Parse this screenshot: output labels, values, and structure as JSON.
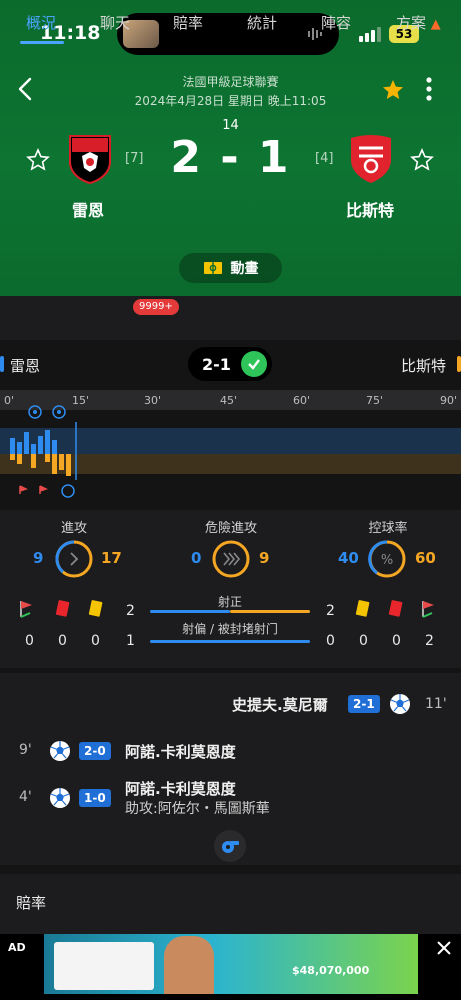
{
  "status_bar": {
    "time": "11:18",
    "battery": "53"
  },
  "match": {
    "league": "法國甲級足球聯賽",
    "datetime": "2024年4月28日 星期日 晚上11:05",
    "minute": "14",
    "score": "2 - 1",
    "home": {
      "name": "雷恩",
      "rank": "[7]"
    },
    "away": {
      "name": "比斯特",
      "rank": "[4]"
    },
    "animation_label": "動畫"
  },
  "tabs": [
    {
      "label": "概況",
      "active": true
    },
    {
      "label": "聊天"
    },
    {
      "label": "賠率"
    },
    {
      "label": "統計"
    },
    {
      "label": "陣容"
    },
    {
      "label": "方案"
    }
  ],
  "chat_badge": "9999+",
  "summary": {
    "home_name": "雷恩",
    "away_name": "比斯特",
    "score": "2-1",
    "ticks": [
      "0'",
      "15'",
      "30'",
      "45'",
      "60'",
      "75'",
      "90'"
    ]
  },
  "stats": {
    "attack": {
      "label": "進攻",
      "home": "9",
      "away": "17"
    },
    "dangerous": {
      "label": "危險進攻",
      "home": "0",
      "away": "9"
    },
    "possession": {
      "label": "控球率",
      "home": "40",
      "away": "60"
    },
    "on_target": {
      "label": "射正",
      "home": "2",
      "away": "2"
    },
    "off_target": {
      "label": "射偏 / 被封堵射门",
      "home": "1",
      "away": "0"
    },
    "home_corners": "0",
    "home_red": "0",
    "home_yellow": "0",
    "away_yellow": "0",
    "away_red": "0",
    "away_corners": "2"
  },
  "events": [
    {
      "side": "away",
      "player": "史提夫.莫尼爾",
      "score": "2-1",
      "minute": "11'"
    },
    {
      "side": "home",
      "player": "阿諾.卡利莫恩度",
      "score": "2-0",
      "minute": "9'"
    },
    {
      "side": "home",
      "player": "阿諾.卡利莫恩度",
      "assist": "助攻:阿佐尔・馬圖斯華",
      "score": "1-0",
      "minute": "4'"
    }
  ],
  "odds_title": "賠率",
  "ad": {
    "label": "AD",
    "amount": "$48,070,000"
  },
  "colors": {
    "header_green": "#0d7432",
    "accent_blue": "#2e8cf0",
    "accent_orange": "#f5a623",
    "tab_active": "#4aa3ff"
  }
}
